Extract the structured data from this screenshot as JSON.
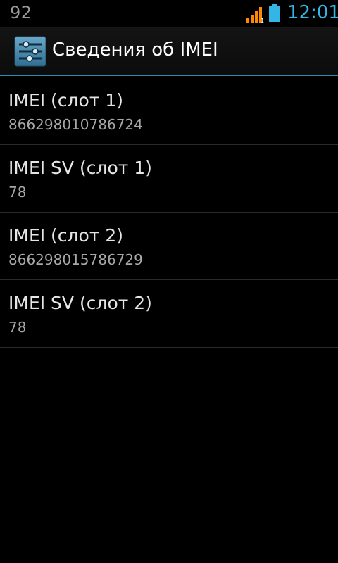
{
  "status_bar": {
    "left_number": "92",
    "signal_icon": "signal-strength-icon",
    "signal_color": "#ff8a00",
    "battery_icon": "battery-icon",
    "battery_color": "#33b5e5",
    "time": "12:01",
    "time_color": "#33b5e5"
  },
  "action_bar": {
    "icon": "settings-sliders-icon",
    "title": "Сведения об IMEI",
    "divider_color": "#2b8cb4"
  },
  "items": [
    {
      "title": "IMEI (слот 1)",
      "value": "866298010786724"
    },
    {
      "title": "IMEI SV (слот 1)",
      "value": "78"
    },
    {
      "title": "IMEI (слот 2)",
      "value": "866298015786729"
    },
    {
      "title": "IMEI SV (слот 2)",
      "value": "78"
    }
  ]
}
